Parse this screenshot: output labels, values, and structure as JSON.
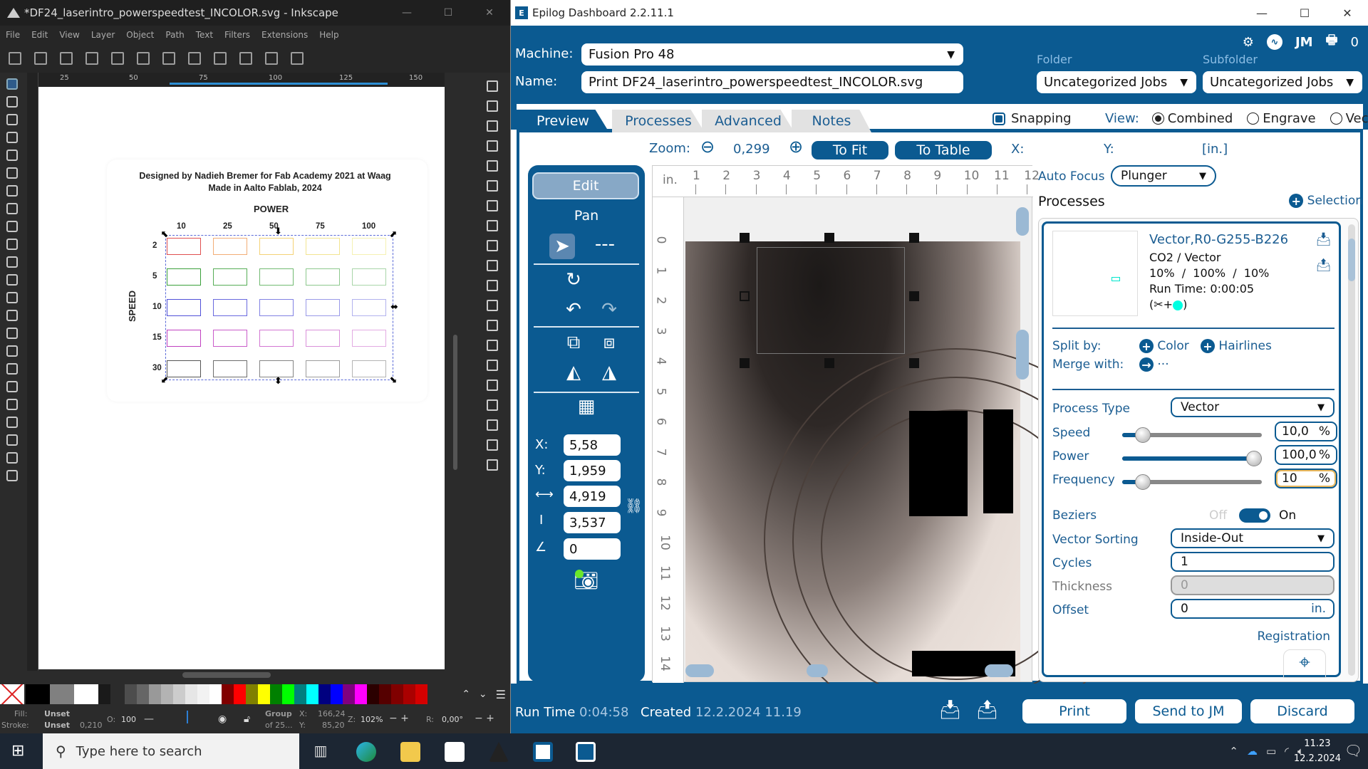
{
  "inkscape": {
    "title": "*DF24_laserintro_powerspeedtest_INCOLOR.svg - Inkscape",
    "menu": [
      "File",
      "Edit",
      "View",
      "Layer",
      "Object",
      "Path",
      "Text",
      "Filters",
      "Extensions",
      "Help"
    ],
    "ruler_top": [
      "25",
      "50",
      "75",
      "100",
      "125",
      "150"
    ],
    "document": {
      "line1": "Designed by Nadieh Bremer for Fab Academy 2021 at Waag",
      "line2": "Made in Aalto Fablab, 2024",
      "power_label": "POWER",
      "speed_label": "SPEED",
      "power_values": [
        "10",
        "25",
        "50",
        "75",
        "100"
      ],
      "speed_values": [
        "2",
        "5",
        "10",
        "15",
        "30"
      ],
      "row_colors": [
        "#e05050",
        "#3aa03a",
        "#5050d8",
        "#c040c0",
        "#555555"
      ],
      "col_tints": [
        "#e05050",
        "#f0a060",
        "#f0c040",
        "#e8d040",
        "#e8e050"
      ]
    },
    "status": {
      "fill_label": "Fill:",
      "fill_value": "Unset",
      "stroke_label": "Stroke:",
      "stroke_value": "Unset",
      "stroke_width": "0,210",
      "opacity_label": "O:",
      "opacity": "100",
      "selection": "Group",
      "selection_sub": "of 25...",
      "x_label": "X:",
      "x": "166,24",
      "y_label": "Y:",
      "y": "85,20",
      "zoom_label": "Z:",
      "zoom": "102%",
      "rotate_label": "R:",
      "rotate": "0,00°"
    },
    "palette": [
      "#000000",
      "#808080",
      "#ffffff",
      "#1a1a1a",
      "#4d4d4d",
      "#666666",
      "#999999",
      "#b3b3b3",
      "#cccccc",
      "#e6e6e6",
      "#f2f2f2",
      "#ffffff",
      "#800000",
      "#ff0000",
      "#808000",
      "#ffff00",
      "#008000",
      "#00ff00",
      "#008080",
      "#00ffff",
      "#000080",
      "#0000ff",
      "#800080",
      "#ff00ff",
      "#2b0000",
      "#550000",
      "#800000",
      "#aa0000",
      "#d40000"
    ]
  },
  "epilog": {
    "title": "Epilog Dashboard 2.2.11.1",
    "header": {
      "machine_label": "Machine:",
      "machine_value": "Fusion Pro 48",
      "name_label": "Name:",
      "name_value": "Print DF24_laserintro_powerspeedtest_INCOLOR.svg",
      "folder_label": "Folder",
      "folder_value": "Uncategorized Jobs",
      "subfolder_label": "Subfolder",
      "subfolder_value": "Uncategorized Jobs",
      "jm_label": "JM",
      "queue_count": "0"
    },
    "tabs": [
      "Preview",
      "Processes",
      "Advanced",
      "Notes"
    ],
    "snapping_label": "Snapping",
    "view_label": "View:",
    "view_options": [
      "Combined",
      "Engrave",
      "Vector"
    ],
    "view_selected": "Combined",
    "zoom_label": "Zoom:",
    "zoom_value": "0,299",
    "to_fit": "To Fit",
    "to_table": "To Table",
    "x_label": "X:",
    "y_label": "Y:",
    "unit_label": "[in.]",
    "side": {
      "edit": "Edit",
      "pan": "Pan",
      "x_label": "X:",
      "x": "5,58",
      "y_label": "Y:",
      "y": "1,959",
      "width": "4,919",
      "height": "3,537",
      "angle": "0"
    },
    "ruler_unit": "in.",
    "ruler_x": [
      "1",
      "2",
      "3",
      "4",
      "5",
      "6",
      "7",
      "8",
      "9",
      "10",
      "11",
      "12"
    ],
    "ruler_y": [
      "0",
      "1",
      "2",
      "3",
      "4",
      "5",
      "6",
      "7",
      "8",
      "9",
      "10",
      "11",
      "12",
      "13",
      "14"
    ],
    "right": {
      "autofocus_label": "Auto Focus",
      "autofocus_value": "Plunger",
      "processes_title": "Processes",
      "selection_label": "Selection",
      "process": {
        "name": "Vector,R0-G255-B226",
        "type": "CO2 / Vector",
        "params": "10%  /  100%  /  10%",
        "runtime": "Run Time: 0:00:05",
        "color": "#00ffe2"
      },
      "split_label": "Split by:",
      "split_color": "Color",
      "split_hairlines": "Hairlines",
      "merge_label": "Merge with:",
      "merge_value": "···",
      "process_type_label": "Process Type",
      "process_type": "Vector",
      "speed_label": "Speed",
      "speed": "10,0",
      "speed_pct": 10,
      "power_label": "Power",
      "power": "100,0",
      "power_pct": 100,
      "frequency_label": "Frequency",
      "frequency": "10",
      "frequency_pct": 10,
      "percent": "%",
      "beziers_label": "Beziers",
      "beziers_off": "Off",
      "beziers_on": "On",
      "vector_sorting_label": "Vector Sorting",
      "vector_sorting": "Inside-Out",
      "cycles_label": "Cycles",
      "cycles": "1",
      "thickness_label": "Thickness",
      "thickness": "0",
      "offset_label": "Offset",
      "offset": "0",
      "offset_unit": "in.",
      "registration_label": "Registration"
    },
    "footer": {
      "runtime_label": "Run Time",
      "runtime": "0:04:58",
      "created_label": "Created",
      "created": "12.2.2024 11.19",
      "print": "Print",
      "send": "Send to JM",
      "discard": "Discard"
    }
  },
  "taskbar": {
    "search_placeholder": "Type here to search",
    "time": "11.23",
    "date": "12.2.2024"
  }
}
